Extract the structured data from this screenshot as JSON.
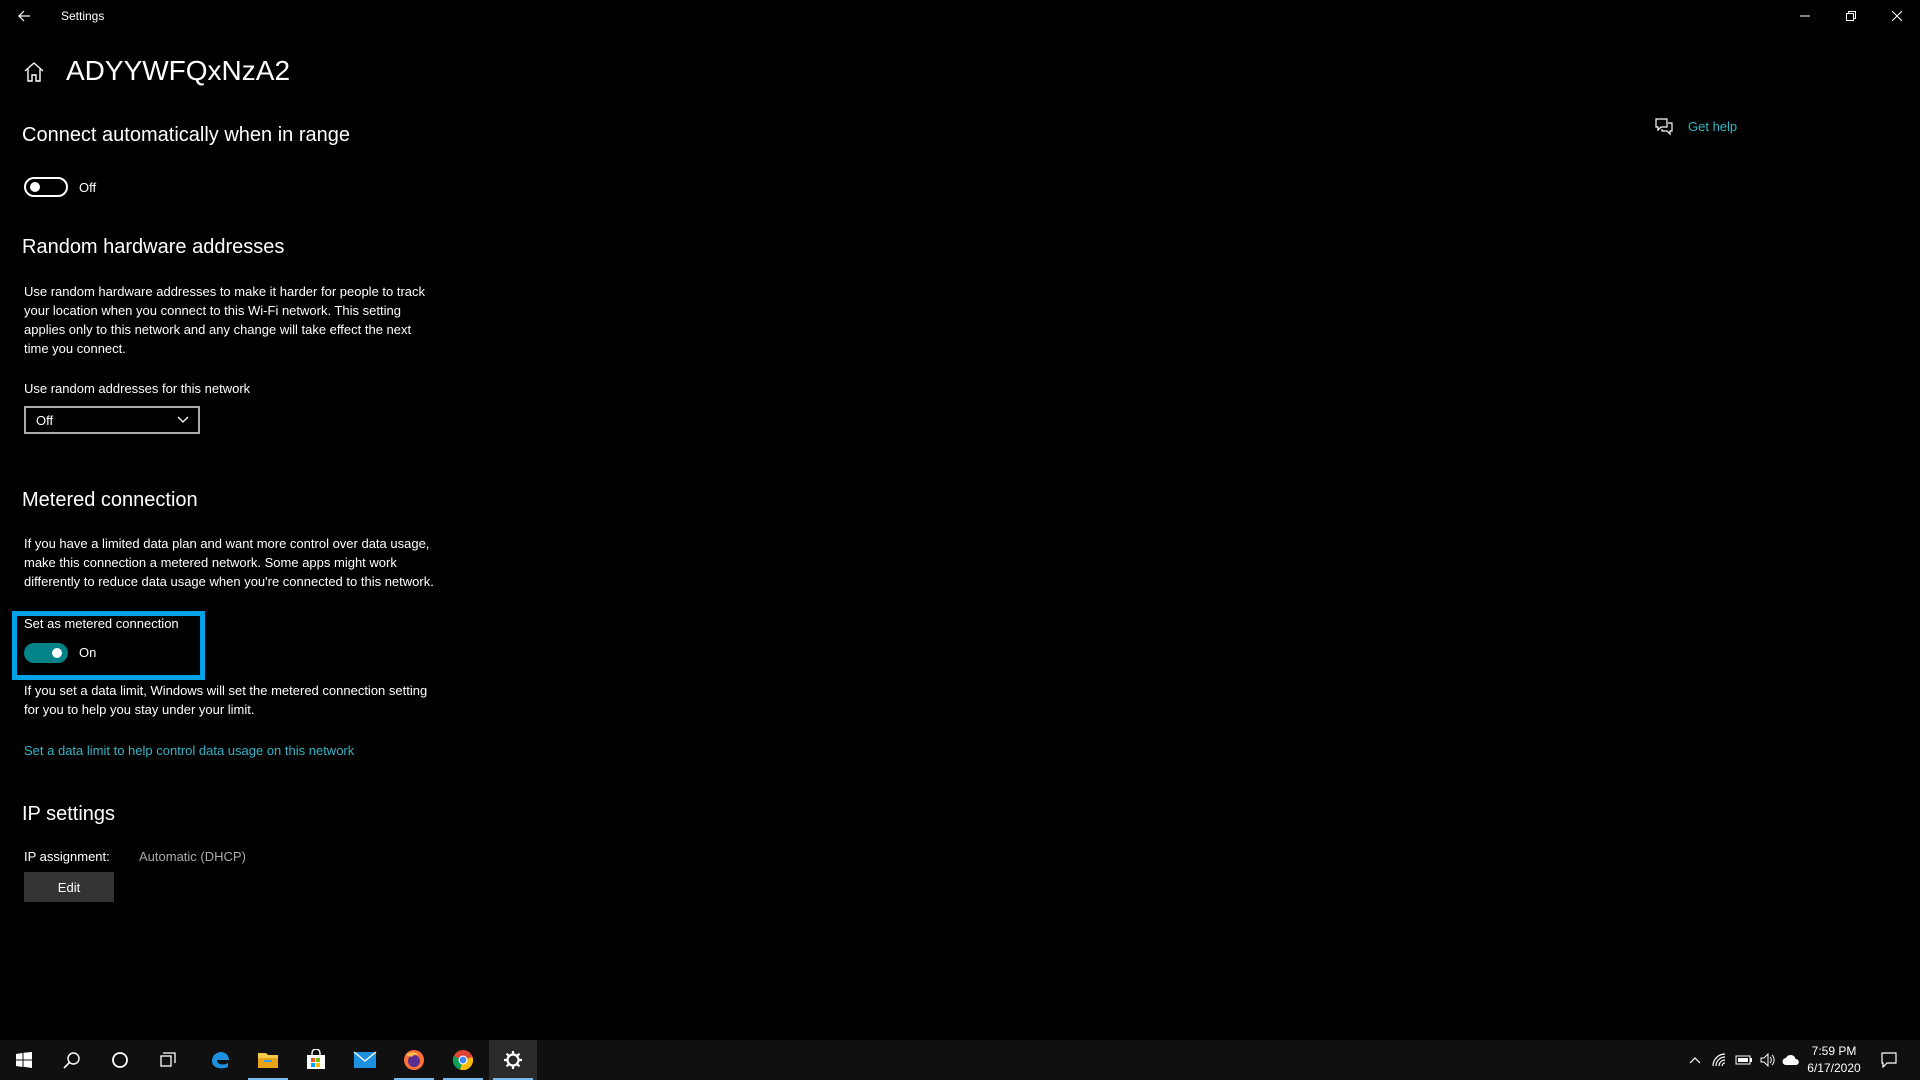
{
  "window": {
    "title": "Settings"
  },
  "page": {
    "title": "ADYYWFQxNzA2"
  },
  "help": {
    "label": "Get help"
  },
  "connect_auto": {
    "heading": "Connect automatically when in range",
    "state": "Off"
  },
  "random_hw": {
    "heading": "Random hardware addresses",
    "description_lines": [
      "Use random hardware addresses to make it harder for people to track",
      "your location when you connect to this Wi-Fi network. This setting",
      "applies only to this network and any change will take effect the next",
      "time you connect."
    ],
    "dropdown_label": "Use random addresses for this network",
    "dropdown_value": "Off"
  },
  "metered": {
    "heading": "Metered connection",
    "description_lines": [
      "If you have a limited data plan and want more control over data usage,",
      "make this connection a metered network. Some apps might work",
      "differently to reduce data usage when you're connected to this network."
    ],
    "toggle_label": "Set as metered connection",
    "state": "On",
    "limit_text_lines": [
      "If you set a data limit, Windows will set the metered connection setting",
      "for you to help you stay under your limit."
    ],
    "limit_link": "Set a data limit to help control data usage on this network"
  },
  "ip": {
    "heading": "IP settings",
    "assignment_label": "IP assignment:",
    "assignment_value": "Automatic (DHCP)",
    "edit_label": "Edit"
  },
  "taskbar": {
    "clock_time": "7:59 PM",
    "clock_date": "6/17/2020",
    "apps": [
      "start-icon",
      "search-icon",
      "cortana-icon",
      "task-view-icon",
      "edge-icon",
      "file-explorer-icon",
      "store-icon",
      "mail-icon",
      "firefox-icon",
      "chrome-icon",
      "settings-icon"
    ]
  },
  "colors": {
    "accent": "#038387",
    "link": "#35b3c7",
    "highlight": "#00a2e8"
  }
}
